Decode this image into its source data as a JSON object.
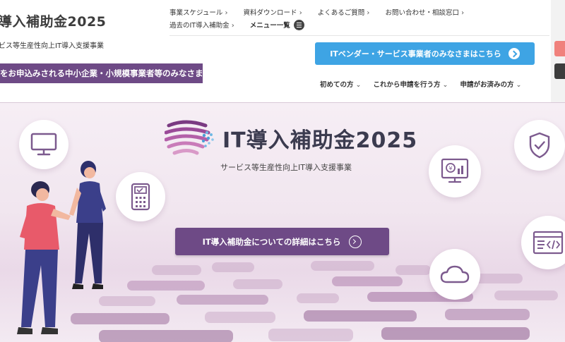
{
  "site": {
    "title": "導入補助金2025",
    "subtitle": "ビス等生産性向上IT導入支援事業",
    "applicant_banner": "をお申込みされる中小企業・小規模事業者等のみなさま"
  },
  "topnav": {
    "row1": [
      "事業スケジュール",
      "資料ダウンロード",
      "よくあるご質問",
      "お問い合わせ・相談窓口"
    ],
    "row2_link": "過去のIT導入補助金",
    "menu_label": "メニュー一覧"
  },
  "vendor_button": {
    "label": "ITベンダー・サービス事業者のみなさまはこちら"
  },
  "subnav": [
    "初めての方",
    "これから申請を行う方",
    "申請がお済みの方"
  ],
  "hero": {
    "logo_text": "IT導入補助金2025",
    "logo_sub": "サービス等生産性向上IT導入支援事業",
    "detail_button": "IT導入補助金についての詳細はこちら"
  },
  "colors": {
    "brand_purple": "#6e4a86",
    "vendor_blue": "#3ea4e4",
    "side_red": "#f0817c"
  },
  "icons": [
    "menu-icon",
    "arrow-circle-icon",
    "monitor-icon",
    "payment-terminal-icon",
    "shield-check-icon",
    "yen-chart-screen-icon",
    "code-window-icon",
    "cloud-icon"
  ]
}
